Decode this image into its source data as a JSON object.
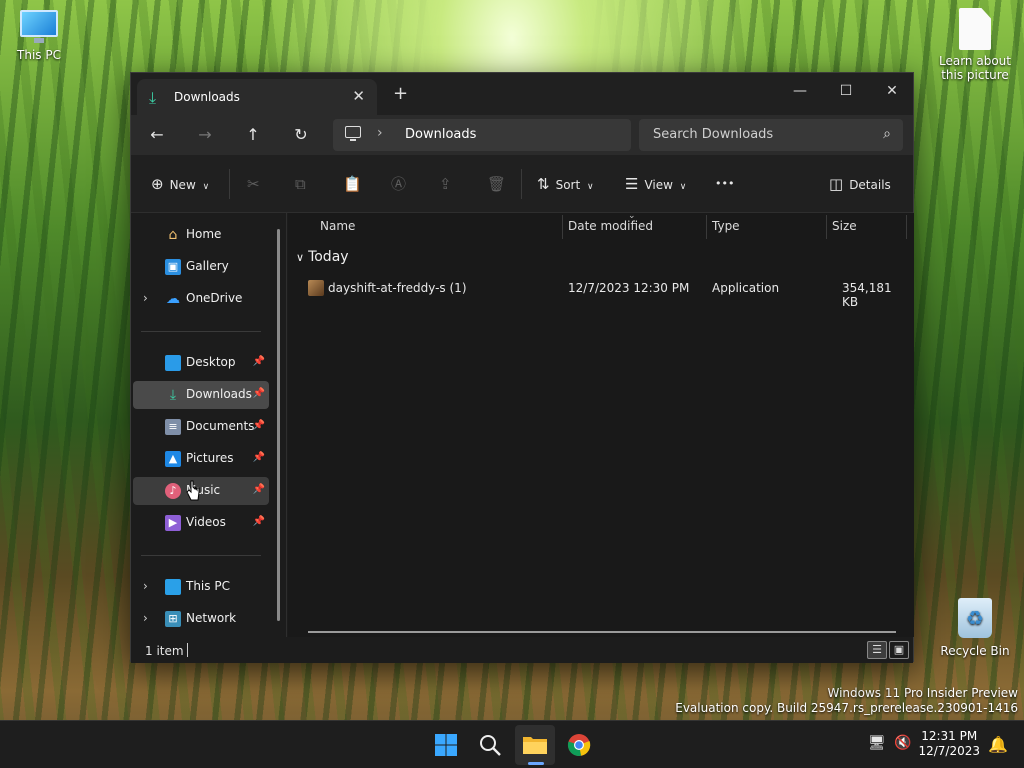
{
  "desktop": {
    "icons": [
      {
        "label": "This PC"
      },
      {
        "label": "Learn about this picture"
      },
      {
        "label": "Recycle Bin"
      }
    ],
    "watermark": {
      "line1": "Windows 11 Pro Insider Preview",
      "line2": "Evaluation copy. Build 25947.rs_prerelease.230901-1416"
    }
  },
  "window": {
    "tab_title": "Downloads",
    "new_tab_glyph": "+",
    "controls": {
      "minimize": "—",
      "maximize": "☐",
      "close": "✕"
    },
    "address": {
      "segment": "Downloads"
    },
    "search": {
      "placeholder": "Search Downloads"
    },
    "commands": {
      "new_label": "New",
      "sort_label": "Sort",
      "view_label": "View",
      "more_label": "•••",
      "details_label": "Details"
    },
    "sidebar": {
      "items": [
        {
          "label": "Home"
        },
        {
          "label": "Gallery"
        },
        {
          "label": "OneDrive"
        },
        {
          "label": "Desktop"
        },
        {
          "label": "Downloads"
        },
        {
          "label": "Documents"
        },
        {
          "label": "Pictures"
        },
        {
          "label": "Music"
        },
        {
          "label": "Videos"
        },
        {
          "label": "This PC"
        },
        {
          "label": "Network"
        }
      ],
      "selected": "Downloads"
    },
    "columns": [
      "Name",
      "Date modified",
      "Type",
      "Size"
    ],
    "group_label": "Today",
    "files": [
      {
        "name": "dayshift-at-freddy-s (1)",
        "date": "12/7/2023 12:30 PM",
        "type": "Application",
        "size": "354,181 KB"
      }
    ],
    "status": {
      "count": "1 item"
    }
  },
  "taskbar": {
    "clock": {
      "time": "12:31 PM",
      "date": "12/7/2023"
    },
    "accent": "#6aa7ff"
  }
}
